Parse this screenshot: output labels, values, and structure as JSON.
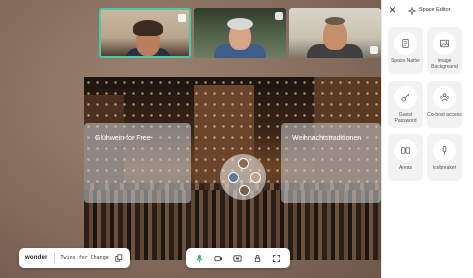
{
  "stage": {
    "videos": [
      {
        "name": "participant-video-1",
        "active": true
      },
      {
        "name": "participant-video-2",
        "active": false
      },
      {
        "name": "participant-video-3",
        "active": false
      }
    ],
    "areas": [
      {
        "title": "Glühwein for Free"
      },
      {
        "title": "Weihnachtstraditionen"
      }
    ]
  },
  "info": {
    "logo_text": "wonder",
    "room_name": "Twins for Change",
    "copy_icon": "copy-icon"
  },
  "toolbar": {
    "buttons": [
      {
        "icon": "microphone-icon"
      },
      {
        "icon": "camera-icon"
      },
      {
        "icon": "screen-share-icon"
      },
      {
        "icon": "lock-icon"
      },
      {
        "icon": "fullscreen-icon"
      }
    ]
  },
  "side_panel": {
    "title": "Space Editor",
    "tools": [
      {
        "label": "Space Name",
        "icon": "document-icon"
      },
      {
        "label": "Image Background",
        "icon": "image-icon"
      },
      {
        "label": "Guest Password",
        "icon": "key-icon"
      },
      {
        "label": "Co-host access",
        "icon": "users-icon"
      },
      {
        "label": "Areas",
        "icon": "areas-icon"
      },
      {
        "label": "Icebreaker",
        "icon": "microphone-icon"
      }
    ]
  },
  "colors": {
    "active_tile_border": "#48c9a8",
    "stage_background": "#8a7161",
    "accent": "#e25a2b"
  }
}
